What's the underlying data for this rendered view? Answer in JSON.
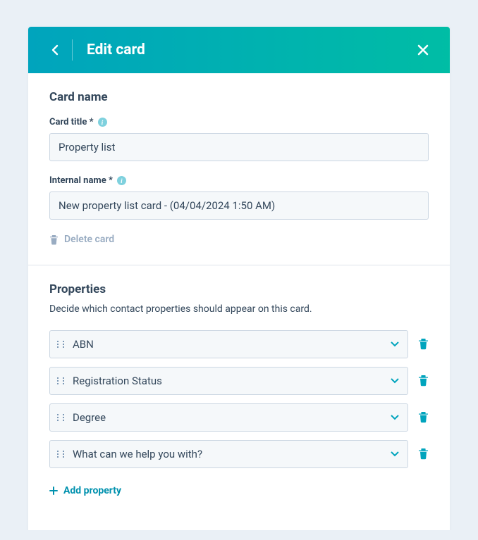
{
  "header": {
    "title": "Edit card"
  },
  "card_name_section": {
    "title": "Card name",
    "card_title_label": "Card title *",
    "card_title_value": "Property list",
    "internal_name_label": "Internal name *",
    "internal_name_value": "New property list card - (04/04/2024 1:50 AM)",
    "delete_label": "Delete card"
  },
  "properties_section": {
    "title": "Properties",
    "description": "Decide which contact properties should appear on this card.",
    "items": [
      {
        "label": "ABN"
      },
      {
        "label": "Registration Status"
      },
      {
        "label": "Degree"
      },
      {
        "label": "What can we help you with?"
      }
    ],
    "add_label": "Add property"
  }
}
